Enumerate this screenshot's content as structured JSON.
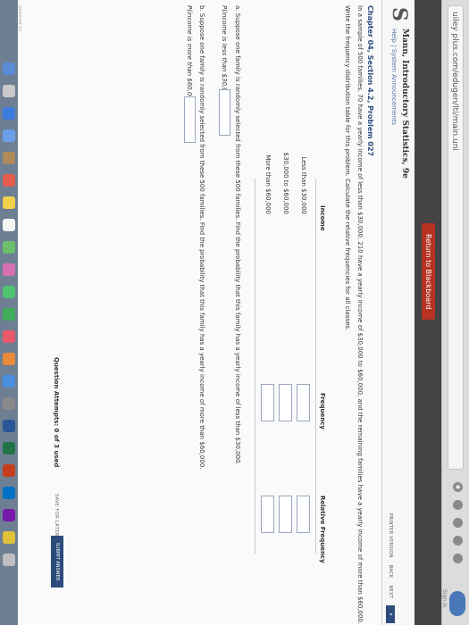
{
  "browser": {
    "url": "uiley plus.com/edugen/lti/main.uni",
    "sign_in": "Sign in"
  },
  "bb_bar": {
    "return_label": "Return to Blackboard"
  },
  "header": {
    "logo": "S",
    "book_title": "Mann, Introductory Statistics, 9e",
    "book_subtitle": "Help | System Announcements",
    "links": [
      "PRINTER VERSION",
      "BACK",
      "NEXT"
    ],
    "close": "✕"
  },
  "problem": {
    "title": "Chapter 04, Section 4.2, Problem 027",
    "intro": "In a sample of 500 families, 70 have a yearly income of less than $30,000, 210 have a yearly income of $30,000 to $60,000, and the remaining families have a yearly income of more than $60,000.",
    "instruction": "Write the frequency distribution table for this problem. Calculate the relative frequencies for all classes.",
    "table": {
      "headers": [
        "Income",
        "Frequency",
        "Relative Frequency"
      ],
      "rows": [
        "Less than $30,000",
        "$30,000 to $60,000",
        "More than $60,000"
      ]
    },
    "part_a": "a. Suppose one family is randomly selected from these 500 families. Find the probability that this family has a yearly income of less than $30,000.",
    "part_a_label": "P(income is less than $30,000) =",
    "part_b": "b. Suppose one family is randomly selected from these 500 families. Find the probability that this family has a yearly income of more than $60,000.",
    "part_b_label": "P(income is more than $60,000) =",
    "attempts_label": "Question Attempts:",
    "attempts_value": "0 of 3 used",
    "save_later": "SAVE FOR LATER",
    "submit": "SUBMIT ANSWER"
  },
  "footer": {
    "powered_by": "powered by"
  },
  "colors": {
    "accent": "#2d4b7c",
    "return_button": "#b63221",
    "dock": "#6e7f94"
  },
  "dock": {
    "icons": [
      "finder-icon",
      "launchpad-icon",
      "safari-icon",
      "mail-icon",
      "contacts-icon",
      "calendar-icon",
      "notes-icon",
      "reminders-icon",
      "maps-icon",
      "photos-icon",
      "messages-icon",
      "facetime-icon",
      "music-icon",
      "books-icon",
      "app-store-icon",
      "preferences-icon",
      "word-icon",
      "excel-icon",
      "powerpoint-icon",
      "outlook-icon",
      "onenote-icon",
      "chrome-icon",
      "trash-icon"
    ]
  }
}
